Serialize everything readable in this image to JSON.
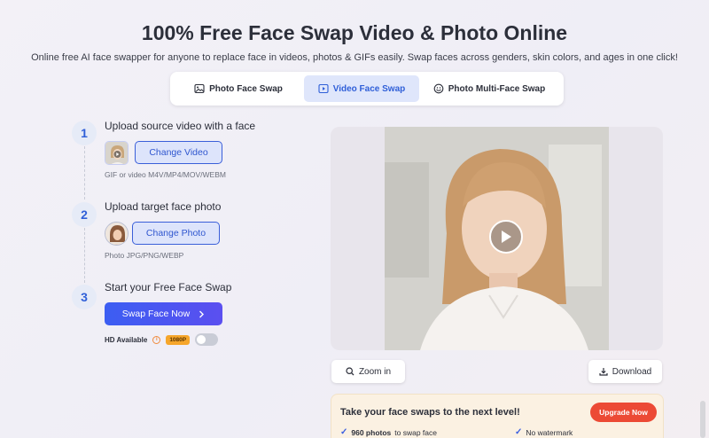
{
  "header": {
    "title": "100% Free Face Swap Video & Photo Online",
    "subtitle": "Online free AI face swapper for anyone to replace face in videos, photos & GIFs easily. Swap faces across genders, skin colors, and ages in one click!"
  },
  "tabs": [
    {
      "label": "Photo Face Swap",
      "icon": "image-icon",
      "active": false
    },
    {
      "label": "Video Face Swap",
      "icon": "video-icon",
      "active": true
    },
    {
      "label": "Photo Multi-Face Swap",
      "icon": "multi-face-icon",
      "active": false
    }
  ],
  "steps": {
    "s1": {
      "num": "1",
      "title": "Upload source video with a face",
      "button": "Change Video",
      "hint": "GIF or video M4V/MP4/MOV/WEBM"
    },
    "s2": {
      "num": "2",
      "title": "Upload target face photo",
      "button": "Change Photo",
      "hint": "Photo JPG/PNG/WEBP"
    },
    "s3": {
      "num": "3",
      "title": "Start your Free Face Swap",
      "button": "Swap Face Now",
      "button_icon": "chevron-right-icon"
    }
  },
  "hd": {
    "label": "HD Available",
    "badge": "1080P",
    "toggle_on": false
  },
  "preview": {
    "zoom_label": "Zoom in",
    "download_label": "Download"
  },
  "upgrade": {
    "title": "Take your face swaps to the next level!",
    "button": "Upgrade Now",
    "feature1_bold": "960 photos",
    "feature1_rest": "to swap face",
    "feature2": "No watermark"
  },
  "colors": {
    "accent": "#2f5fd8",
    "upgrade_red": "#ec4a35",
    "badge_orange": "#f6a62b"
  }
}
